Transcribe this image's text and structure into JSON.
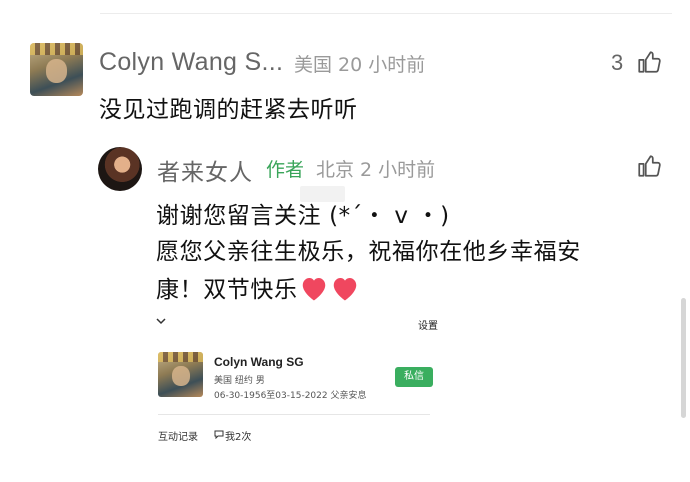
{
  "comment": {
    "author": "Colyn Wang S...",
    "meta": "美国 20 小时前",
    "likes": "3",
    "body": "没见过跑调的赶紧去听听"
  },
  "reply": {
    "author": "者来女人",
    "badge": "作者",
    "meta": "北京 2 小时前",
    "lines": [
      "谢谢您留言关注 (*´・ v ・)",
      "愿您父亲往生极乐，祝福你在他乡幸福安",
      "康！双节快乐"
    ],
    "heart_color": "#f0475f"
  },
  "profile_card": {
    "settings_label": "设置",
    "name": "Colyn Wang SG",
    "location": "美国  纽约  男",
    "dates": "06-30-1956至03-15-2022 父亲安息",
    "message_button": "私信",
    "interactions_label": "互动记录",
    "chat_count": "我2次"
  },
  "colors": {
    "accent_green": "#3aa55a",
    "meta_gray": "#9a9a9a"
  },
  "icons": {
    "like": "thumbs-up-icon",
    "chat": "chat-bubble-icon",
    "chevron": "chevron-down-icon"
  }
}
